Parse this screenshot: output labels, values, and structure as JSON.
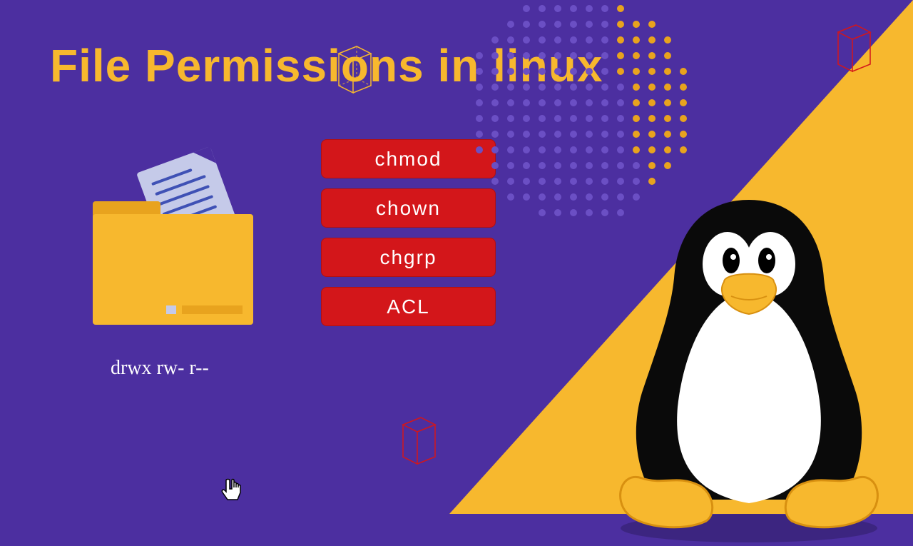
{
  "title": "File Permissions in linux",
  "permission_string": "drwx rw- r--",
  "commands": [
    {
      "label": "chmod"
    },
    {
      "label": "chown"
    },
    {
      "label": "chgrp"
    },
    {
      "label": "ACL"
    }
  ]
}
